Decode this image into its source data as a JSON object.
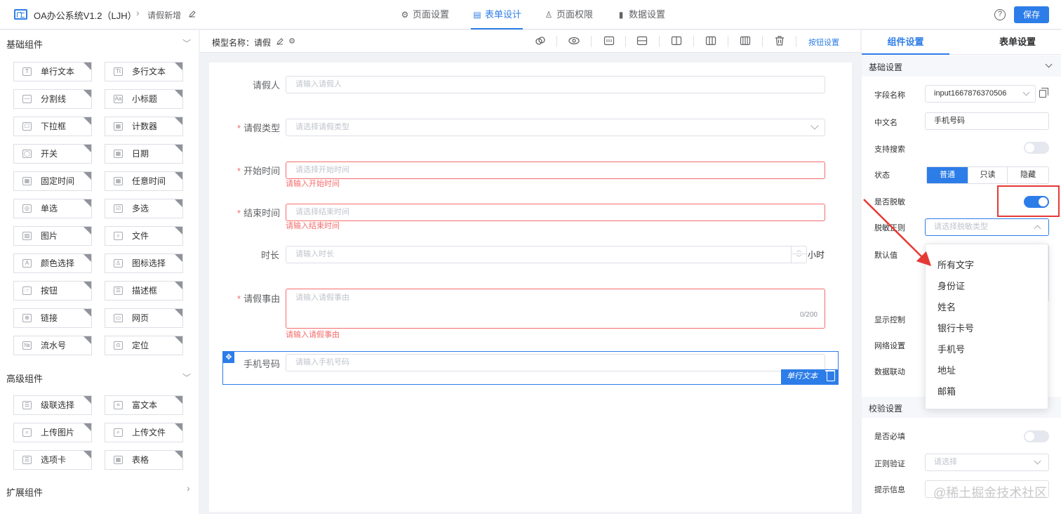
{
  "header": {
    "app_title": "OA办公系统V1.2（LJH）",
    "breadcrumb_sep": "›",
    "page_name": "请假新增",
    "tabs": [
      {
        "icon": "gear-icon",
        "label": "页面设置"
      },
      {
        "icon": "form-icon",
        "label": "表单设计"
      },
      {
        "icon": "user-icon",
        "label": "页面权限"
      },
      {
        "icon": "bar-chart-icon",
        "label": "数据设置"
      }
    ],
    "help": "?",
    "save_label": "保存"
  },
  "left_panel": {
    "basic_title": "基础组件",
    "basic_items": [
      "单行文本",
      "多行文本",
      "分割线",
      "小标题",
      "下拉框",
      "计数器",
      "开关",
      "日期",
      "固定时间",
      "任意时间",
      "单选",
      "多选",
      "图片",
      "文件",
      "颜色选择",
      "图标选择",
      "按钮",
      "描述框",
      "链接",
      "网页",
      "流水号",
      "定位"
    ],
    "basic_icons": [
      "T",
      "Tt",
      "—",
      "Aa",
      "☐",
      "▦",
      "◯",
      "▦",
      "▦",
      "▦",
      "◎",
      "☑",
      "▨",
      "⌕",
      "A",
      "♙",
      "☞",
      "☰",
      "⊕",
      "▭",
      "№",
      "⊙"
    ],
    "advanced_title": "高级组件",
    "advanced_items": [
      "级联选择",
      "富文本",
      "上传图片",
      "上传文件",
      "选项卡",
      "表格"
    ],
    "advanced_icons": [
      "☰",
      "⌗",
      "⌕",
      "⌕",
      "☰",
      "▦"
    ],
    "extend_title": "扩展组件"
  },
  "toolbar": {
    "model_label": "模型名称：请假",
    "button_settings": "按钮设置"
  },
  "form": {
    "fields": [
      {
        "label": "请假人",
        "placeholder": "请输入请假人",
        "required": false
      },
      {
        "label": "请假类型",
        "placeholder": "请选择请假类型",
        "required": true
      },
      {
        "label": "开始时间",
        "placeholder": "请选择开始时间",
        "required": true,
        "error": "请输入开始时间"
      },
      {
        "label": "结束时间",
        "placeholder": "请选择结束时间",
        "required": true,
        "error": "请输入结束时间"
      },
      {
        "label": "时长",
        "placeholder": "请输入时长",
        "required": false,
        "suffix": "小时"
      },
      {
        "label": "请假事由",
        "placeholder": "请输入请假事由",
        "required": true,
        "error": "请输入请假事由",
        "counter": "0/200"
      },
      {
        "label": "手机号码",
        "placeholder": "请输入手机号码",
        "required": false
      }
    ],
    "required_mark": "*",
    "selected_tag": "单行文本",
    "move_icon": "✥"
  },
  "right_panel": {
    "tabs": [
      "组件设置",
      "表单设置"
    ],
    "basic_section": "基础设置",
    "field_name_label": "字段名称",
    "field_name_value": "input1667876370506",
    "cn_name_label": "中文名",
    "cn_name_value": "手机号码",
    "search_label": "支持搜索",
    "status_label": "状态",
    "status_options": [
      "普通",
      "只读",
      "隐藏"
    ],
    "mask_label": "是否脱敏",
    "mask_rule_label": "脱敏正则",
    "mask_rule_placeholder": "请选择脱敏类型",
    "default_label": "默认值",
    "display_label": "显示控制",
    "network_label": "网络设置",
    "linkage_label": "数据联动",
    "validate_section": "校验设置",
    "required_label": "是否必填",
    "regex_label": "正则验证",
    "regex_placeholder": "请选择",
    "tip_label": "提示信息"
  },
  "dropdown": {
    "options": [
      "所有文字",
      "身份证",
      "姓名",
      "银行卡号",
      "手机号",
      "地址",
      "邮箱"
    ]
  },
  "watermark": "@稀土掘金技术社区",
  "colors": {
    "accent": "#2d7de8",
    "error": "#f56c6c",
    "annotation": "#e53935"
  }
}
